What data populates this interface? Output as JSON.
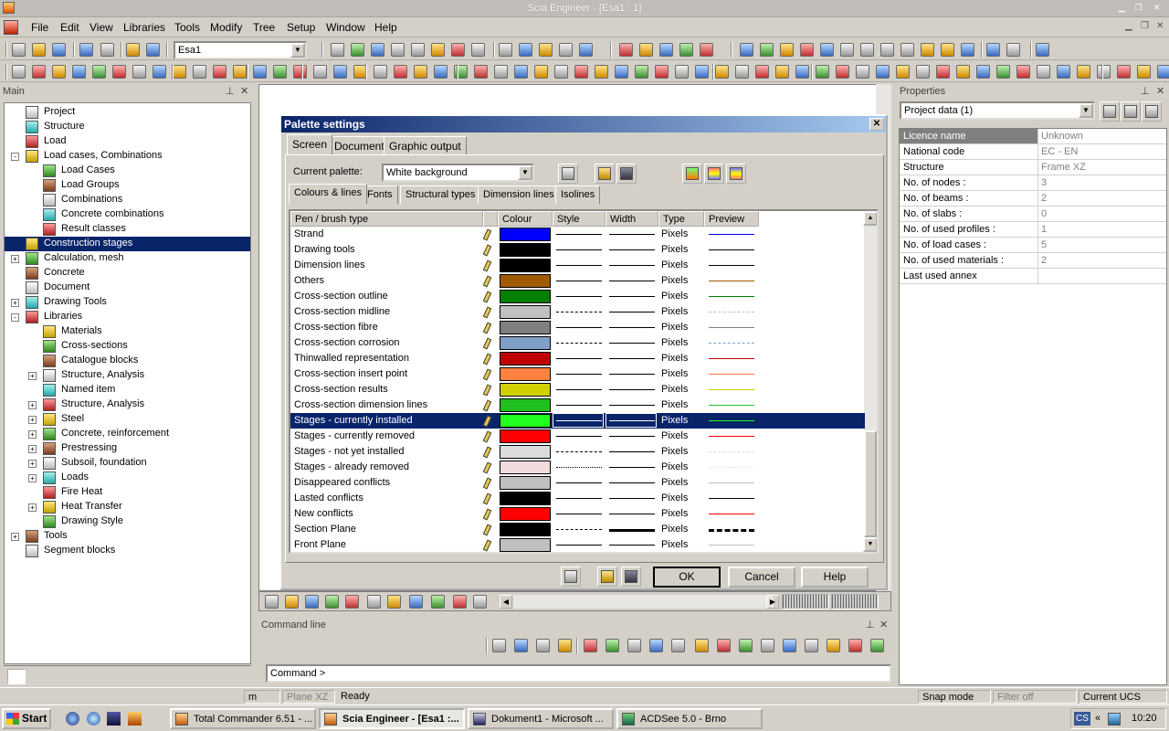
{
  "app": {
    "window_title": "Scia Engineer - [Esa1 : 1]"
  },
  "menu": [
    "File",
    "Edit",
    "View",
    "Libraries",
    "Tools",
    "Modify",
    "Tree",
    "Setup",
    "Window",
    "Help"
  ],
  "toolbar": {
    "document_combo": "Esa1"
  },
  "main_panel": {
    "title": "Main",
    "tree": [
      {
        "label": "Project",
        "level": 1,
        "expand": ""
      },
      {
        "label": "Structure",
        "level": 1,
        "expand": ""
      },
      {
        "label": "Load",
        "level": 1,
        "expand": ""
      },
      {
        "label": "Load cases, Combinations",
        "level": 1,
        "expand": "-"
      },
      {
        "label": "Load Cases",
        "level": 2,
        "expand": ""
      },
      {
        "label": "Load Groups",
        "level": 2,
        "expand": ""
      },
      {
        "label": "Combinations",
        "level": 2,
        "expand": ""
      },
      {
        "label": "Concrete combinations",
        "level": 2,
        "expand": ""
      },
      {
        "label": "Result classes",
        "level": 2,
        "expand": ""
      },
      {
        "label": "Construction stages",
        "level": 1,
        "expand": "",
        "selected": true
      },
      {
        "label": "Calculation, mesh",
        "level": 1,
        "expand": "+"
      },
      {
        "label": "Concrete",
        "level": 1,
        "expand": ""
      },
      {
        "label": "Document",
        "level": 1,
        "expand": ""
      },
      {
        "label": "Drawing Tools",
        "level": 1,
        "expand": "+"
      },
      {
        "label": "Libraries",
        "level": 1,
        "expand": "-"
      },
      {
        "label": "Materials",
        "level": 2,
        "expand": ""
      },
      {
        "label": "Cross-sections",
        "level": 2,
        "expand": ""
      },
      {
        "label": "Catalogue blocks",
        "level": 2,
        "expand": ""
      },
      {
        "label": "Structure, Analysis",
        "level": 2,
        "expand": "+"
      },
      {
        "label": "Named item",
        "level": 2,
        "expand": ""
      },
      {
        "label": "Structure, Analysis",
        "level": 2,
        "expand": "+"
      },
      {
        "label": "Steel",
        "level": 2,
        "expand": "+"
      },
      {
        "label": "Concrete, reinforcement",
        "level": 2,
        "expand": "+"
      },
      {
        "label": "Prestressing",
        "level": 2,
        "expand": "+"
      },
      {
        "label": "Subsoil, foundation",
        "level": 2,
        "expand": "+"
      },
      {
        "label": "Loads",
        "level": 2,
        "expand": "+"
      },
      {
        "label": "Fire Heat",
        "level": 2,
        "expand": ""
      },
      {
        "label": "Heat Transfer",
        "level": 2,
        "expand": "+"
      },
      {
        "label": "Drawing Style",
        "level": 2,
        "expand": ""
      },
      {
        "label": "Tools",
        "level": 1,
        "expand": "+"
      },
      {
        "label": "Segment blocks",
        "level": 1,
        "expand": ""
      }
    ]
  },
  "properties_panel": {
    "title": "Properties",
    "combo": "Project data (1)",
    "rows": [
      {
        "key": "Licence name",
        "value": "Unknown"
      },
      {
        "key": "National code",
        "value": "EC - EN"
      },
      {
        "key": "Structure",
        "value": "Frame XZ"
      },
      {
        "key": "No. of nodes :",
        "value": "3"
      },
      {
        "key": "No. of beams :",
        "value": "2"
      },
      {
        "key": "No. of slabs :",
        "value": "0"
      },
      {
        "key": "No. of used profiles :",
        "value": "1"
      },
      {
        "key": "No. of load cases :",
        "value": "5"
      },
      {
        "key": "No. of used materials :",
        "value": "2"
      },
      {
        "key": "Last used annex",
        "value": ""
      }
    ]
  },
  "dialog": {
    "title": "Palette settings",
    "tabs": [
      "Screen",
      "Document",
      "Graphic output"
    ],
    "current_palette_label": "Current palette:",
    "current_palette_value": "White background",
    "subtabs": [
      "Colours & lines",
      "Fonts",
      "Structural types",
      "Dimension lines",
      "Isolines"
    ],
    "columns": [
      "Pen / brush type",
      "Colour",
      "Style",
      "Width",
      "Type",
      "Preview"
    ],
    "rows": [
      {
        "name": "Strand",
        "color": "#0000ff",
        "dash": "solid",
        "thick": 1,
        "type": "Pixels"
      },
      {
        "name": "Drawing tools",
        "color": "#000000",
        "dash": "solid",
        "thick": 1,
        "type": "Pixels"
      },
      {
        "name": "Dimension lines",
        "color": "#000000",
        "dash": "solid",
        "thick": 1,
        "type": "Pixels"
      },
      {
        "name": "Others",
        "color": "#a05a00",
        "dash": "solid",
        "thick": 1,
        "type": "Pixels"
      },
      {
        "name": "Cross-section outline",
        "color": "#008000",
        "dash": "solid",
        "thick": 1,
        "type": "Pixels"
      },
      {
        "name": "Cross-section midline",
        "color": "#c0c0c0",
        "dash": "dashdot",
        "thick": 1,
        "type": "Pixels"
      },
      {
        "name": "Cross-section fibre",
        "color": "#808080",
        "dash": "solid",
        "thick": 1,
        "type": "Pixels"
      },
      {
        "name": "Cross-section corrosion",
        "color": "#80a0c8",
        "dash": "dashed",
        "thick": 1,
        "type": "Pixels"
      },
      {
        "name": "Thinwalled representation",
        "color": "#c00000",
        "dash": "solid",
        "thick": 1,
        "type": "Pixels"
      },
      {
        "name": "Cross-section insert point",
        "color": "#ff8040",
        "dash": "solid",
        "thick": 1,
        "type": "Pixels"
      },
      {
        "name": "Cross-section results",
        "color": "#d0d000",
        "dash": "solid",
        "thick": 1,
        "type": "Pixels"
      },
      {
        "name": "Cross-section dimension lines",
        "color": "#20c020",
        "dash": "solid",
        "thick": 1,
        "type": "Pixels"
      },
      {
        "name": "Stages - currently installed",
        "color": "#20ff20",
        "dash": "solid",
        "thick": 1,
        "type": "Pixels",
        "selected": true
      },
      {
        "name": "Stages - currently removed",
        "color": "#ff0000",
        "dash": "solid",
        "thick": 1,
        "type": "Pixels"
      },
      {
        "name": "Stages - not yet installed",
        "color": "#dcdcdc",
        "dash": "dashed",
        "thick": 1,
        "type": "Pixels"
      },
      {
        "name": "Stages - already removed",
        "color": "#f0dcdc",
        "dash": "dotted",
        "thick": 1,
        "type": "Pixels"
      },
      {
        "name": "Disappeared conflicts",
        "color": "#c0c0c0",
        "dash": "solid",
        "thick": 1,
        "type": "Pixels"
      },
      {
        "name": "Lasted conflicts",
        "color": "#000000",
        "dash": "solid",
        "thick": 1,
        "type": "Pixels"
      },
      {
        "name": "New conflicts",
        "color": "#ff0000",
        "dash": "solid",
        "thick": 1,
        "type": "Pixels"
      },
      {
        "name": "Section Plane",
        "color": "#000000",
        "dash": "dashdot",
        "thick": 3,
        "type": "Pixels"
      },
      {
        "name": "Front Plane",
        "color": "#c0c0c0",
        "dash": "solid",
        "thick": 1,
        "type": "Pixels"
      }
    ],
    "ok_label": "OK",
    "cancel_label": "Cancel",
    "help_label": "Help"
  },
  "command_panel": {
    "title": "Command line",
    "prompt": "Command >"
  },
  "statusbar": {
    "unit": "m",
    "plane": "Plane XZ",
    "status": "Ready",
    "snap": "Snap mode",
    "filter": "Filter off",
    "ucs": "Current UCS"
  },
  "taskbar": {
    "start": "Start",
    "tasks": [
      "Total Commander 6.51 - ...",
      "Scia Engineer - [Esa1 :...",
      "Dokument1 - Microsoft ...",
      "ACDSee 5.0 - Brno"
    ],
    "tray_lang": "CS",
    "time": "10:20"
  }
}
